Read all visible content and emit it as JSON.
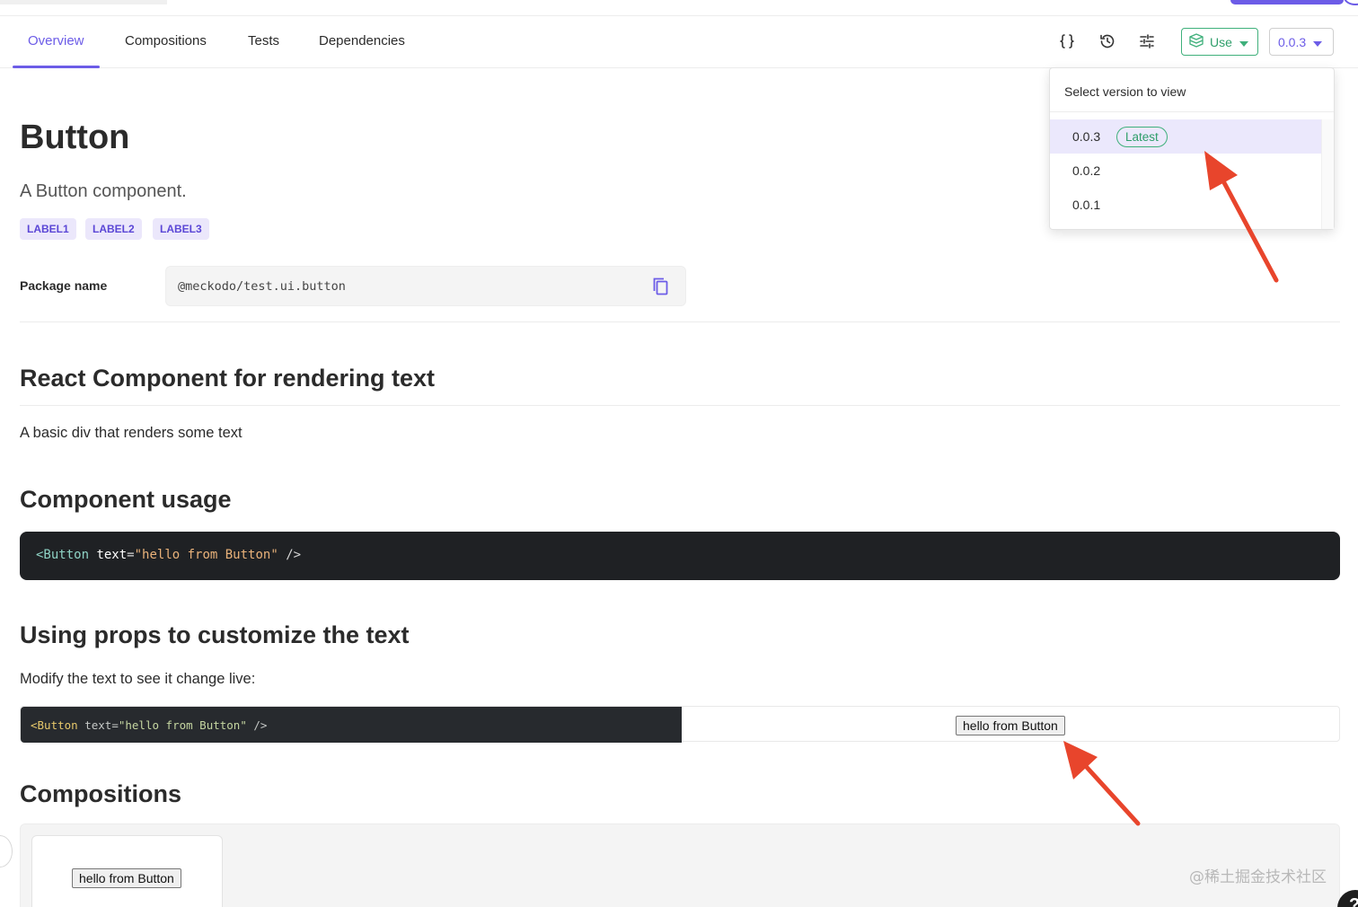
{
  "nav": {
    "tabs": [
      {
        "label": "Overview",
        "active": true
      },
      {
        "label": "Compositions",
        "active": false
      },
      {
        "label": "Tests",
        "active": false
      },
      {
        "label": "Dependencies",
        "active": false
      }
    ],
    "icons": [
      "code-braces-icon",
      "history-icon",
      "settings-sliders-icon"
    ],
    "use_label": "Use",
    "version_label": "0.0.3"
  },
  "colors": {
    "accent": "#6c5ce7",
    "green": "#3fb07b",
    "code_bg": "#1f2124",
    "arrow": "#e8452c"
  },
  "component": {
    "title": "Button",
    "description": "A Button component.",
    "labels": [
      "LABEL1",
      "LABEL2",
      "LABEL3"
    ],
    "package_label": "Package name",
    "package_name": "@meckodo/test.ui.button"
  },
  "sections": {
    "react_heading": "React Component for rendering text",
    "react_text": "A basic div that renders some text",
    "usage_heading": "Component usage",
    "usage_code": {
      "tag_open": "<Button",
      "attr": "text",
      "eq": "=",
      "value": "\"hello from Button\"",
      "close": " />"
    },
    "props_heading": "Using props to customize the text",
    "props_text": "Modify the text to see it change live:",
    "live_code": {
      "tag_open": "<Button",
      "attr": "text",
      "eq": "=",
      "value": "\"hello from Button\"",
      "close": " />"
    },
    "live_preview_button": "hello from Button",
    "compositions_heading": "Compositions",
    "composition_button": "hello from Button"
  },
  "version_dropdown": {
    "title": "Select version to view",
    "items": [
      {
        "version": "0.0.3",
        "badge": "Latest",
        "selected": true
      },
      {
        "version": "0.0.2",
        "badge": "",
        "selected": false
      },
      {
        "version": "0.0.1",
        "badge": "",
        "selected": false
      }
    ]
  },
  "watermark": "@稀土掘金技术社区",
  "help": "?"
}
